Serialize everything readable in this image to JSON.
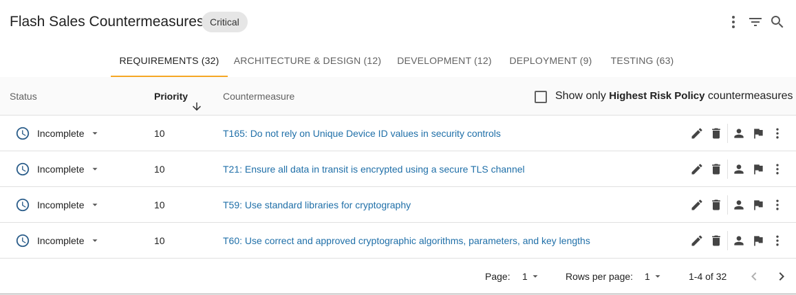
{
  "header": {
    "title": "Flash Sales Countermeasures",
    "badge": "Critical",
    "icons": [
      "more-vertical-icon",
      "filter-icon",
      "search-icon"
    ]
  },
  "tabs": [
    {
      "label": "REQUIREMENTS (32)",
      "active": true
    },
    {
      "label": "ARCHITECTURE & DESIGN (12)",
      "active": false
    },
    {
      "label": "DEVELOPMENT (12)",
      "active": false
    },
    {
      "label": "DEPLOYMENT (9)",
      "active": false
    },
    {
      "label": "TESTING (63)",
      "active": false
    }
  ],
  "table": {
    "columns": {
      "status": "Status",
      "priority": "Priority",
      "countermeasure": "Countermeasure"
    },
    "sort": {
      "column": "priority",
      "direction": "descending"
    },
    "filter": {
      "checked": false,
      "label_prefix": "Show only ",
      "label_bold": "Highest Risk Policy",
      "label_suffix": " countermeasures"
    },
    "rows": [
      {
        "status": "Incomplete",
        "priority": "10",
        "countermeasure": "T165: Do not rely on Unique Device ID values in security controls"
      },
      {
        "status": "Incomplete",
        "priority": "10",
        "countermeasure": "T21: Ensure all data in transit is encrypted using a secure TLS channel"
      },
      {
        "status": "Incomplete",
        "priority": "10",
        "countermeasure": "T59: Use standard libraries for cryptography"
      },
      {
        "status": "Incomplete",
        "priority": "10",
        "countermeasure": "T60: Use correct and approved cryptographic algorithms, parameters, and key lengths"
      }
    ],
    "row_actions": [
      "edit-icon",
      "delete-icon",
      "assign-user-icon",
      "flag-icon",
      "more-vertical-icon"
    ]
  },
  "pagination": {
    "page_label": "Page:",
    "page_value": "1",
    "rows_label": "Rows per page:",
    "rows_value": "1",
    "range": "1-4 of 32"
  },
  "colors": {
    "accent": "#f5a623",
    "link": "#1f6fa8",
    "status_icon": "#2b5d8a"
  }
}
